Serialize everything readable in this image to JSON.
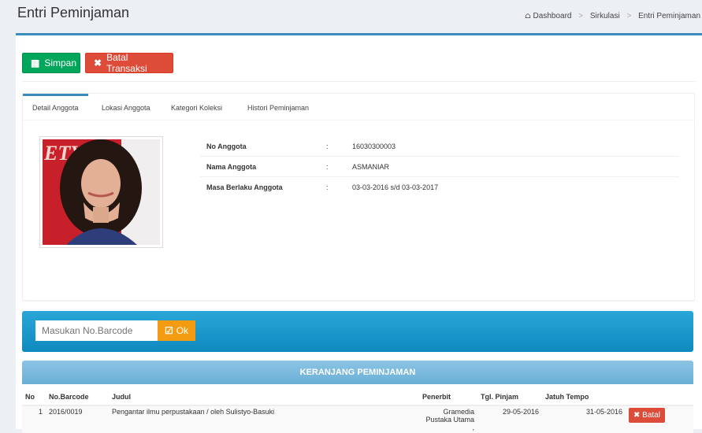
{
  "header": {
    "title": "Entri Peminjaman",
    "breadcrumb": [
      "Dashboard",
      "Sirkulasi",
      "Entri Peminjaman"
    ]
  },
  "toolbar": {
    "save_label": "Simpan",
    "cancel_label": "Batal Transaksi"
  },
  "tabs": [
    {
      "label": "Detail Anggota",
      "active": true
    },
    {
      "label": "Lokasi Anggota",
      "active": false
    },
    {
      "label": "Kategori Koleksi",
      "active": false
    },
    {
      "label": "Histori Peminjaman",
      "active": false
    }
  ],
  "member": {
    "rows": [
      {
        "label": "No Anggota",
        "value": "16030300003"
      },
      {
        "label": "Nama Anggota",
        "value": "ASMANIAR"
      },
      {
        "label": "Masa Berlaku Anggota",
        "value": "03-03-2016 s/d 03-03-2017"
      }
    ],
    "colon": ":",
    "photo_text": "ETY"
  },
  "barcode": {
    "placeholder": "Masukan No.Barcode",
    "ok_label": "Ok"
  },
  "cart": {
    "title": "KERANJANG PEMINJAMAN",
    "columns": [
      "No",
      "No.Barcode",
      "Judul",
      "Penerbit",
      "Tgl. Pinjam",
      "Jatuh Tempo",
      ""
    ],
    "rows": [
      {
        "no": "1",
        "barcode": "2016/0019",
        "judul": "Pengantar ilmu perpustakaan / oleh Sulistyo-Basuki",
        "penerbit": "Gramedia Pustaka Utama ,",
        "tgl_pinjam": "29-05-2016",
        "jatuh_tempo": "31-05-2016",
        "action": "Batal"
      }
    ]
  },
  "colors": {
    "accent": "#3c8dbc",
    "success": "#00a65a",
    "danger": "#dd4b39",
    "warning": "#f39c12"
  }
}
